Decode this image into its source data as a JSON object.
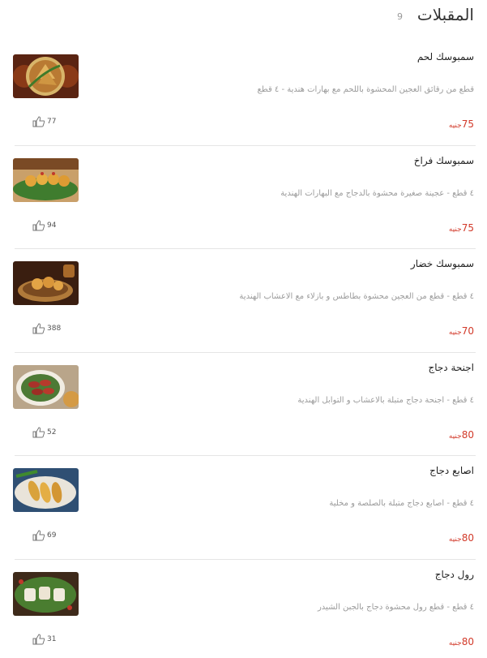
{
  "section": {
    "title": "المقبلات",
    "count": "9"
  },
  "items": [
    {
      "name": "سمبوسك لحم",
      "description": "قطع من رقائق العجين المحشوة باللحم مع بهارات هندية - ٤ قطع",
      "price": "75",
      "currency": "جنيه",
      "likes": "77"
    },
    {
      "name": "سمبوسك فراخ",
      "description": "٤ قطع - عجينة صغيرة محشوة بالدجاج مع البهارات الهندية",
      "price": "75",
      "currency": "جنيه",
      "likes": "94"
    },
    {
      "name": "سمبوسك خضار",
      "description": "٤ قطع - قطع من العجين محشوة بطاطس و بازلاء مع الاعشاب الهندية",
      "price": "70",
      "currency": "جنيه",
      "likes": "388"
    },
    {
      "name": "اجنحة دجاج",
      "description": "٤ قطع - اجنحة دجاج متبلة بالاعشاب و التوابل الهندية",
      "price": "80",
      "currency": "جنيه",
      "likes": "52"
    },
    {
      "name": "اصابع دجاج",
      "description": "٤ قطع - اصابع دجاج متبلة بالصلصة و مخلية",
      "price": "80",
      "currency": "جنيه",
      "likes": "69"
    },
    {
      "name": "رول دجاج",
      "description": "٤ قطع - قطع رول محشوة دجاج بالجبن الشيدر",
      "price": "80",
      "currency": "جنيه",
      "likes": "31"
    }
  ],
  "icons": {
    "like": "thumbs-up-icon"
  },
  "colors": {
    "price": "#d23a2a",
    "muted": "#9b9b9b",
    "divider": "#e5e5e5"
  }
}
